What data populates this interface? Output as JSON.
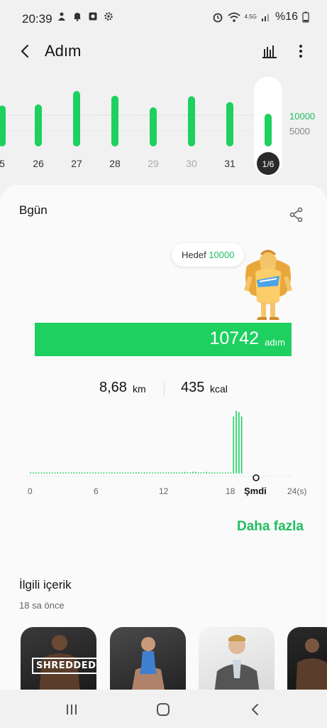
{
  "status_bar": {
    "time": "20:39",
    "network_label": "4.5G",
    "battery": "%16"
  },
  "header": {
    "title": "Adım"
  },
  "daily_strip": {
    "days": [
      {
        "label": "5",
        "value": 7000,
        "dim": false
      },
      {
        "label": "26",
        "value": 7200,
        "dim": false
      },
      {
        "label": "27",
        "value": 9500,
        "dim": false
      },
      {
        "label": "28",
        "value": 8700,
        "dim": false
      },
      {
        "label": "29",
        "value": 6700,
        "dim": true
      },
      {
        "label": "30",
        "value": 8600,
        "dim": true
      },
      {
        "label": "31",
        "value": 7600,
        "dim": false
      },
      {
        "label": "1/6",
        "value": 5600,
        "dim": false,
        "selected": true
      }
    ],
    "ref_10000": "10000",
    "ref_5000": "5000",
    "accent": "#1ed05f"
  },
  "card": {
    "title": "Bgün",
    "goal_label": "Hedef",
    "goal_value": "10000",
    "goal_progress_fraction": 1.0,
    "steps_value": "10742",
    "steps_unit": "adım",
    "distance_value": "8,68",
    "distance_unit": "km",
    "kcal_value": "435",
    "kcal_unit": "kcal"
  },
  "hourly": {
    "axis_labels": [
      "0",
      "6",
      "12",
      "18"
    ],
    "end_label": "24(s)",
    "now_label": "Şmdi",
    "values": [
      2,
      1,
      2,
      1,
      1,
      2,
      1,
      1,
      1,
      1,
      1,
      2,
      1,
      1,
      1,
      1,
      2,
      1,
      2,
      1,
      1,
      2,
      1,
      2,
      1,
      1,
      1,
      1,
      1,
      1,
      1,
      2,
      1,
      1,
      1,
      1,
      1,
      1,
      1,
      1,
      2,
      1,
      2,
      1,
      2,
      1,
      1,
      2,
      1,
      2,
      2,
      2,
      2,
      2,
      2,
      1,
      1,
      3,
      2,
      1,
      3,
      3,
      1,
      2,
      1,
      3,
      2,
      1,
      1,
      1,
      1,
      1,
      1,
      1,
      1,
      100,
      110,
      108,
      100
    ]
  },
  "more_link": "Daha fazla",
  "related": {
    "title": "İlgili içerik",
    "time": "18 sa önce",
    "items": [
      {
        "caption": "SHREDDED"
      },
      {
        "caption": ""
      },
      {
        "caption": ""
      },
      {
        "caption": ""
      }
    ]
  }
}
